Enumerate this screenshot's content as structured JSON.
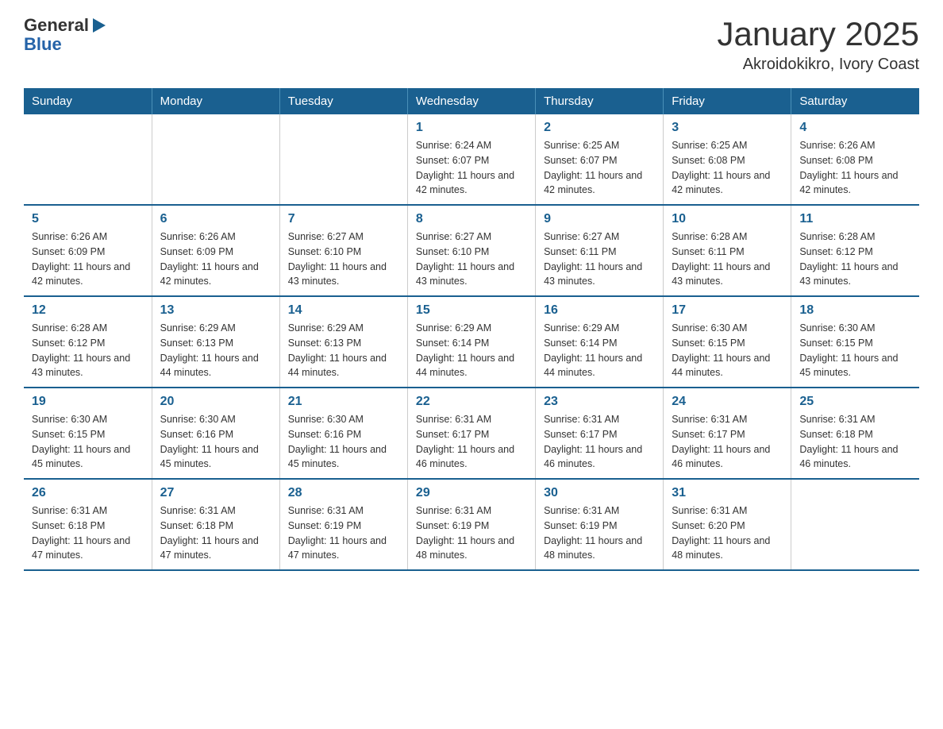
{
  "logo": {
    "text_general": "General",
    "text_blue": "Blue"
  },
  "title": "January 2025",
  "subtitle": "Akroidokikro, Ivory Coast",
  "header": {
    "days": [
      "Sunday",
      "Monday",
      "Tuesday",
      "Wednesday",
      "Thursday",
      "Friday",
      "Saturday"
    ]
  },
  "weeks": [
    [
      {
        "day": "",
        "info": ""
      },
      {
        "day": "",
        "info": ""
      },
      {
        "day": "",
        "info": ""
      },
      {
        "day": "1",
        "info": "Sunrise: 6:24 AM\nSunset: 6:07 PM\nDaylight: 11 hours and 42 minutes."
      },
      {
        "day": "2",
        "info": "Sunrise: 6:25 AM\nSunset: 6:07 PM\nDaylight: 11 hours and 42 minutes."
      },
      {
        "day": "3",
        "info": "Sunrise: 6:25 AM\nSunset: 6:08 PM\nDaylight: 11 hours and 42 minutes."
      },
      {
        "day": "4",
        "info": "Sunrise: 6:26 AM\nSunset: 6:08 PM\nDaylight: 11 hours and 42 minutes."
      }
    ],
    [
      {
        "day": "5",
        "info": "Sunrise: 6:26 AM\nSunset: 6:09 PM\nDaylight: 11 hours and 42 minutes."
      },
      {
        "day": "6",
        "info": "Sunrise: 6:26 AM\nSunset: 6:09 PM\nDaylight: 11 hours and 42 minutes."
      },
      {
        "day": "7",
        "info": "Sunrise: 6:27 AM\nSunset: 6:10 PM\nDaylight: 11 hours and 43 minutes."
      },
      {
        "day": "8",
        "info": "Sunrise: 6:27 AM\nSunset: 6:10 PM\nDaylight: 11 hours and 43 minutes."
      },
      {
        "day": "9",
        "info": "Sunrise: 6:27 AM\nSunset: 6:11 PM\nDaylight: 11 hours and 43 minutes."
      },
      {
        "day": "10",
        "info": "Sunrise: 6:28 AM\nSunset: 6:11 PM\nDaylight: 11 hours and 43 minutes."
      },
      {
        "day": "11",
        "info": "Sunrise: 6:28 AM\nSunset: 6:12 PM\nDaylight: 11 hours and 43 minutes."
      }
    ],
    [
      {
        "day": "12",
        "info": "Sunrise: 6:28 AM\nSunset: 6:12 PM\nDaylight: 11 hours and 43 minutes."
      },
      {
        "day": "13",
        "info": "Sunrise: 6:29 AM\nSunset: 6:13 PM\nDaylight: 11 hours and 44 minutes."
      },
      {
        "day": "14",
        "info": "Sunrise: 6:29 AM\nSunset: 6:13 PM\nDaylight: 11 hours and 44 minutes."
      },
      {
        "day": "15",
        "info": "Sunrise: 6:29 AM\nSunset: 6:14 PM\nDaylight: 11 hours and 44 minutes."
      },
      {
        "day": "16",
        "info": "Sunrise: 6:29 AM\nSunset: 6:14 PM\nDaylight: 11 hours and 44 minutes."
      },
      {
        "day": "17",
        "info": "Sunrise: 6:30 AM\nSunset: 6:15 PM\nDaylight: 11 hours and 44 minutes."
      },
      {
        "day": "18",
        "info": "Sunrise: 6:30 AM\nSunset: 6:15 PM\nDaylight: 11 hours and 45 minutes."
      }
    ],
    [
      {
        "day": "19",
        "info": "Sunrise: 6:30 AM\nSunset: 6:15 PM\nDaylight: 11 hours and 45 minutes."
      },
      {
        "day": "20",
        "info": "Sunrise: 6:30 AM\nSunset: 6:16 PM\nDaylight: 11 hours and 45 minutes."
      },
      {
        "day": "21",
        "info": "Sunrise: 6:30 AM\nSunset: 6:16 PM\nDaylight: 11 hours and 45 minutes."
      },
      {
        "day": "22",
        "info": "Sunrise: 6:31 AM\nSunset: 6:17 PM\nDaylight: 11 hours and 46 minutes."
      },
      {
        "day": "23",
        "info": "Sunrise: 6:31 AM\nSunset: 6:17 PM\nDaylight: 11 hours and 46 minutes."
      },
      {
        "day": "24",
        "info": "Sunrise: 6:31 AM\nSunset: 6:17 PM\nDaylight: 11 hours and 46 minutes."
      },
      {
        "day": "25",
        "info": "Sunrise: 6:31 AM\nSunset: 6:18 PM\nDaylight: 11 hours and 46 minutes."
      }
    ],
    [
      {
        "day": "26",
        "info": "Sunrise: 6:31 AM\nSunset: 6:18 PM\nDaylight: 11 hours and 47 minutes."
      },
      {
        "day": "27",
        "info": "Sunrise: 6:31 AM\nSunset: 6:18 PM\nDaylight: 11 hours and 47 minutes."
      },
      {
        "day": "28",
        "info": "Sunrise: 6:31 AM\nSunset: 6:19 PM\nDaylight: 11 hours and 47 minutes."
      },
      {
        "day": "29",
        "info": "Sunrise: 6:31 AM\nSunset: 6:19 PM\nDaylight: 11 hours and 48 minutes."
      },
      {
        "day": "30",
        "info": "Sunrise: 6:31 AM\nSunset: 6:19 PM\nDaylight: 11 hours and 48 minutes."
      },
      {
        "day": "31",
        "info": "Sunrise: 6:31 AM\nSunset: 6:20 PM\nDaylight: 11 hours and 48 minutes."
      },
      {
        "day": "",
        "info": ""
      }
    ]
  ]
}
